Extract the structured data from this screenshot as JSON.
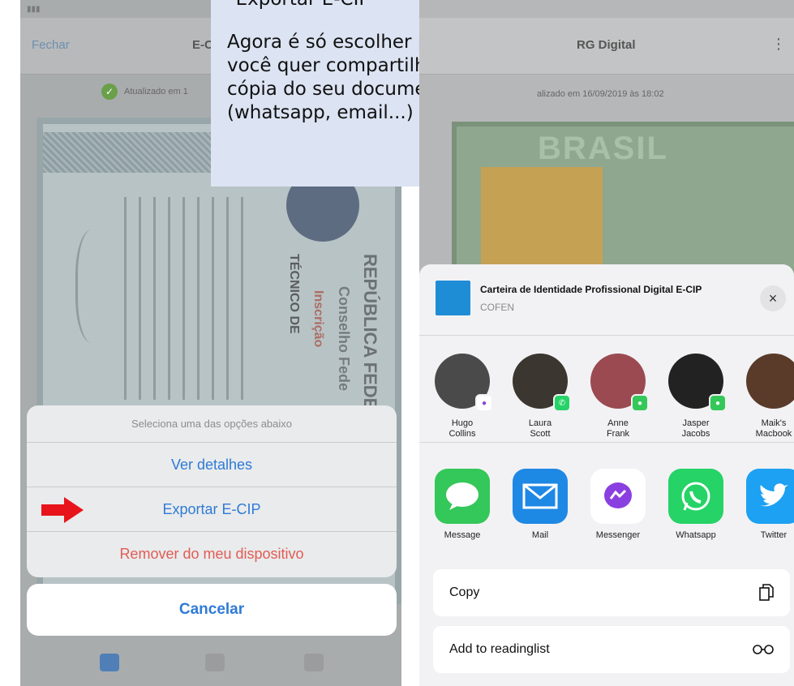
{
  "left_phone": {
    "nav": {
      "close": "Fechar",
      "title": "E-C"
    },
    "updated_text": "Atualizado em 1",
    "document_text": {
      "republica": "REPÚBLICA FEDE",
      "conselho": "Conselho Fede",
      "inscricao": "Inscrição",
      "tecnico": "TÉCNICO DE"
    },
    "action_sheet": {
      "header": "Seleciona uma das opções abaixo",
      "options": [
        "Ver detalhes",
        "Exportar E-CIP",
        "Remover do meu dispositivo"
      ],
      "cancel": "Cancelar"
    }
  },
  "tooltip": {
    "heading": "\"Exportar E-CIP\"",
    "body": "Agora é só escolher para quem você quer compartilhar uma cópia do seu documento (whatsapp, email...)"
  },
  "right_phone": {
    "nav": {
      "title": "RG Digital",
      "more": "⋮"
    },
    "updated_text": "alizado em 16/09/2019 às 18:02",
    "card_text": "BRASIL",
    "share_sheet": {
      "title": "Carteira de Identidade Profissional Digital E-CIP",
      "subtitle": "COFEN",
      "close": "×",
      "contacts": [
        {
          "name": "Hugo\nCollins",
          "badge": "messenger-icon",
          "color": "#4a4a4a"
        },
        {
          "name": "Laura\nScott",
          "badge": "whatsapp-icon",
          "color": "#3b3630"
        },
        {
          "name": "Anne\nFrank",
          "badge": "message-icon",
          "color": "#9b4a52"
        },
        {
          "name": "Jasper\nJacobs",
          "badge": "message-icon",
          "color": "#222222"
        },
        {
          "name": "Maik's\nMacbook",
          "badge": "",
          "color": "#5a3b2a"
        }
      ],
      "apps": [
        {
          "label": "Message",
          "icon": "message-icon",
          "color": "#34c759"
        },
        {
          "label": "Mail",
          "icon": "mail-icon",
          "color": "#1e88e5"
        },
        {
          "label": "Messenger",
          "icon": "messenger-icon",
          "color": "#ffffff"
        },
        {
          "label": "Whatsapp",
          "icon": "whatsapp-icon",
          "color": "#25d366"
        },
        {
          "label": "Twitter",
          "icon": "twitter-icon",
          "color": "#1da1f2"
        }
      ],
      "actions": [
        {
          "label": "Copy",
          "icon": "copy-icon"
        },
        {
          "label": "Add to readinglist",
          "icon": "glasses-icon"
        }
      ]
    }
  },
  "colors": {
    "accent": "#2f7bd6",
    "destructive": "#e25c55",
    "arrow": "#e8141b",
    "tooltip_bg": "#dce3f2"
  }
}
